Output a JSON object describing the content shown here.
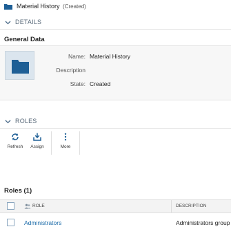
{
  "header": {
    "title": "Material History",
    "status": "(Created)"
  },
  "sections": {
    "details_label": "DETAILS",
    "roles_label": "ROLES"
  },
  "general_data": {
    "title": "General Data",
    "fields": [
      {
        "label": "Name:",
        "value": "Material History"
      },
      {
        "label": "Description",
        "value": ""
      },
      {
        "label": "State:",
        "value": "Created"
      }
    ]
  },
  "toolbar": {
    "refresh_label": "Refresh",
    "assign_label": "Assign",
    "more_label": "More"
  },
  "roles_table": {
    "title": "Roles (1)",
    "columns": {
      "role": "ROLE",
      "description": "DESCRIPTION"
    },
    "rows": [
      {
        "role": "Administrators",
        "description": "Administrators group"
      }
    ]
  },
  "colors": {
    "accent": "#1a6aa8",
    "folder": "#1e5f96",
    "icon_bg": "#dbe5ee"
  }
}
